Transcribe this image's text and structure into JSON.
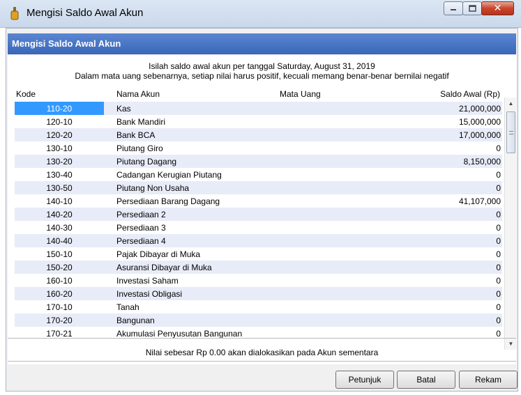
{
  "window": {
    "title": "Mengisi Saldo Awal Akun",
    "minimize_icon": "minimize-icon",
    "maximize_icon": "maximize-icon",
    "close_icon": "close-icon"
  },
  "header": {
    "title": "Mengisi Saldo Awal Akun"
  },
  "instructions": {
    "line1": "Isilah saldo awal akun per tanggal Saturday, August 31, 2019",
    "line2": "Dalam mata uang sebenarnya, setiap nilai harus positif, kecuali memang benar-benar bernilai negatif"
  },
  "table": {
    "columns": {
      "kode": "Kode",
      "nama": "Nama Akun",
      "mata_uang": "Mata Uang",
      "saldo": "Saldo Awal (Rp)"
    },
    "selected_row": 0,
    "rows": [
      {
        "kode": "110-20",
        "nama": "Kas",
        "saldo": "21,000,000"
      },
      {
        "kode": "120-10",
        "nama": "Bank Mandiri",
        "saldo": "15,000,000"
      },
      {
        "kode": "120-20",
        "nama": "Bank BCA",
        "saldo": "17,000,000"
      },
      {
        "kode": "130-10",
        "nama": "Piutang Giro",
        "saldo": "0"
      },
      {
        "kode": "130-20",
        "nama": "Piutang Dagang",
        "saldo": "8,150,000"
      },
      {
        "kode": "130-40",
        "nama": "Cadangan Kerugian Piutang",
        "saldo": "0"
      },
      {
        "kode": "130-50",
        "nama": "Piutang Non Usaha",
        "saldo": "0"
      },
      {
        "kode": "140-10",
        "nama": "Persediaan Barang Dagang",
        "saldo": "41,107,000"
      },
      {
        "kode": "140-20",
        "nama": "Persediaan 2",
        "saldo": "0"
      },
      {
        "kode": "140-30",
        "nama": "Persediaan 3",
        "saldo": "0"
      },
      {
        "kode": "140-40",
        "nama": "Persediaan 4",
        "saldo": "0"
      },
      {
        "kode": "150-10",
        "nama": "Pajak Dibayar di Muka",
        "saldo": "0"
      },
      {
        "kode": "150-20",
        "nama": "Asuransi Dibayar di Muka",
        "saldo": "0"
      },
      {
        "kode": "160-10",
        "nama": "Investasi Saham",
        "saldo": "0"
      },
      {
        "kode": "160-20",
        "nama": "Investasi Obligasi",
        "saldo": "0"
      },
      {
        "kode": "170-10",
        "nama": "Tanah",
        "saldo": "0"
      },
      {
        "kode": "170-20",
        "nama": "Bangunan",
        "saldo": "0"
      },
      {
        "kode": "170-21",
        "nama": "Akumulasi Penyusutan Bangunan",
        "saldo": "0"
      }
    ]
  },
  "footer": {
    "note": "Nilai sebesar Rp 0.00 akan dialokasikan pada Akun sementara"
  },
  "buttons": {
    "petunjuk": "Petunjuk",
    "batal": "Batal",
    "rekam": "Rekam"
  },
  "colors": {
    "header_accent": "#4a76c5",
    "selection": "#3399ff",
    "row_alt": "#e8ecf8"
  }
}
